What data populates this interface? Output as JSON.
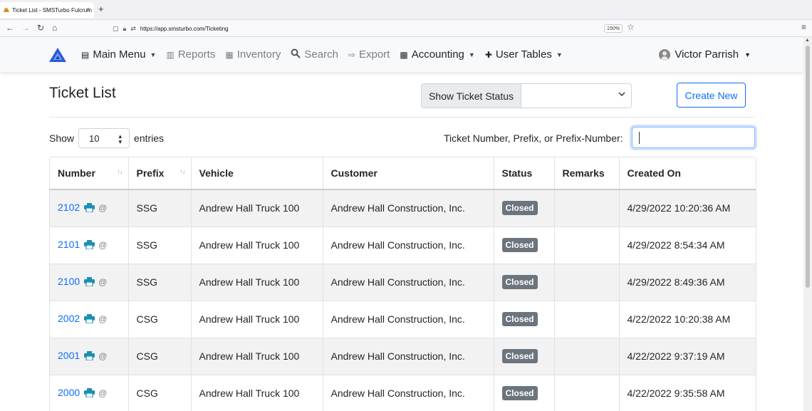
{
  "browser": {
    "tab_title": "Ticket List - SMSTurbo Fulcrum",
    "tab_close": "×",
    "new_tab": "+",
    "url": "https://app.smsturbo.com/Ticketing",
    "zoom": "150%"
  },
  "nav": {
    "main_menu": "Main Menu",
    "reports": "Reports",
    "inventory": "Inventory",
    "search": "Search",
    "export": "Export",
    "accounting": "Accounting",
    "user_tables": "User Tables",
    "user_name": "Victor Parrish"
  },
  "page": {
    "title": "Ticket List",
    "show_ticket_status": "Show Ticket Status",
    "create_new": "Create New",
    "show": "Show",
    "entries_value": "10",
    "entries": "entries",
    "search_label": "Ticket Number, Prefix, or Prefix-Number:"
  },
  "table": {
    "headers": [
      "Number",
      "Prefix",
      "Vehicle",
      "Customer",
      "Status",
      "Remarks",
      "Created On"
    ],
    "rows": [
      {
        "number": "2102",
        "prefix": "SSG",
        "vehicle": "Andrew Hall Truck 100",
        "customer": "Andrew Hall Construction, Inc.",
        "status": "Closed",
        "remarks": "",
        "created": "4/29/2022 10:20:36 AM"
      },
      {
        "number": "2101",
        "prefix": "SSG",
        "vehicle": "Andrew Hall Truck 100",
        "customer": "Andrew Hall Construction, Inc.",
        "status": "Closed",
        "remarks": "",
        "created": "4/29/2022 8:54:34 AM"
      },
      {
        "number": "2100",
        "prefix": "SSG",
        "vehicle": "Andrew Hall Truck 100",
        "customer": "Andrew Hall Construction, Inc.",
        "status": "Closed",
        "remarks": "",
        "created": "4/29/2022 8:49:36 AM"
      },
      {
        "number": "2002",
        "prefix": "CSG",
        "vehicle": "Andrew Hall Truck 100",
        "customer": "Andrew Hall Construction, Inc.",
        "status": "Closed",
        "remarks": "",
        "created": "4/22/2022 10:20:38 AM"
      },
      {
        "number": "2001",
        "prefix": "CSG",
        "vehicle": "Andrew Hall Truck 100",
        "customer": "Andrew Hall Construction, Inc.",
        "status": "Closed",
        "remarks": "",
        "created": "4/22/2022 9:37:19 AM"
      },
      {
        "number": "2000",
        "prefix": "CSG",
        "vehicle": "Andrew Hall Truck 100",
        "customer": "Andrew Hall Construction, Inc.",
        "status": "Closed",
        "remarks": "",
        "created": "4/22/2022 9:35:58 AM"
      }
    ]
  },
  "colors": {
    "link": "#0d6efd",
    "badge": "#6c757d",
    "printer": "#1a8fb5",
    "logo": "#2a5bd7"
  }
}
